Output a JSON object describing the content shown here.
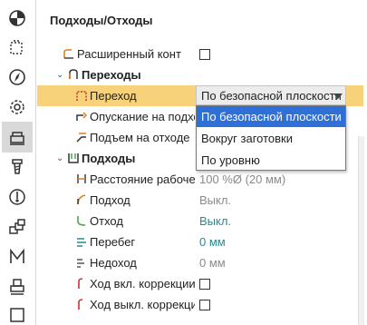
{
  "toolbar": {
    "items": [
      {
        "name": "origin-icon",
        "active": false
      },
      {
        "name": "boundary-icon",
        "active": false
      },
      {
        "name": "compass-icon",
        "active": false
      },
      {
        "name": "gear-icon",
        "active": false
      },
      {
        "name": "link-moves-icon",
        "active": true
      },
      {
        "name": "tool-icon",
        "active": false
      },
      {
        "name": "spindle-icon",
        "active": false
      },
      {
        "name": "stack-icon",
        "active": false
      },
      {
        "name": "m-code-icon",
        "active": false
      },
      {
        "name": "stamp-icon",
        "active": false
      },
      {
        "name": "square-icon",
        "active": false
      }
    ]
  },
  "panel": {
    "title": "Подходы/Отходы",
    "advanced_label": "Расширенный конт",
    "transitions": {
      "label": "Переходы",
      "rows": {
        "transition_label": "Переход",
        "transition_value": "По безопасной плоскости",
        "descent_label": "Опускание на подхо",
        "ascent_label": "Подъем на отходе"
      }
    },
    "approaches": {
      "label": "Подходы",
      "rows": {
        "distance_label": "Расстояние рабоче",
        "distance_value": "100 %Ø (20 мм)",
        "approach_label": "Подход",
        "approach_value": "Выкл.",
        "retract_label": "Отход",
        "retract_value": "Выкл.",
        "overrun_label": "Перебег",
        "overrun_value": "0 мм",
        "underrun_label": "Недоход",
        "underrun_value": "0 мм",
        "comp_on_label": "Ход вкл. коррекции",
        "comp_off_label": "Ход выкл. коррекци"
      }
    }
  },
  "dropdown": {
    "options": [
      "По безопасной плоскости",
      "Вокруг заготовки",
      "По уровню"
    ],
    "highlighted_index": 0
  },
  "colors": {
    "selected_row": "#f7d27a",
    "highlight": "#2f6fd8",
    "teal_value": "#2a8a8f",
    "icon_orange": "#e07b20",
    "icon_green": "#4aa84a"
  }
}
